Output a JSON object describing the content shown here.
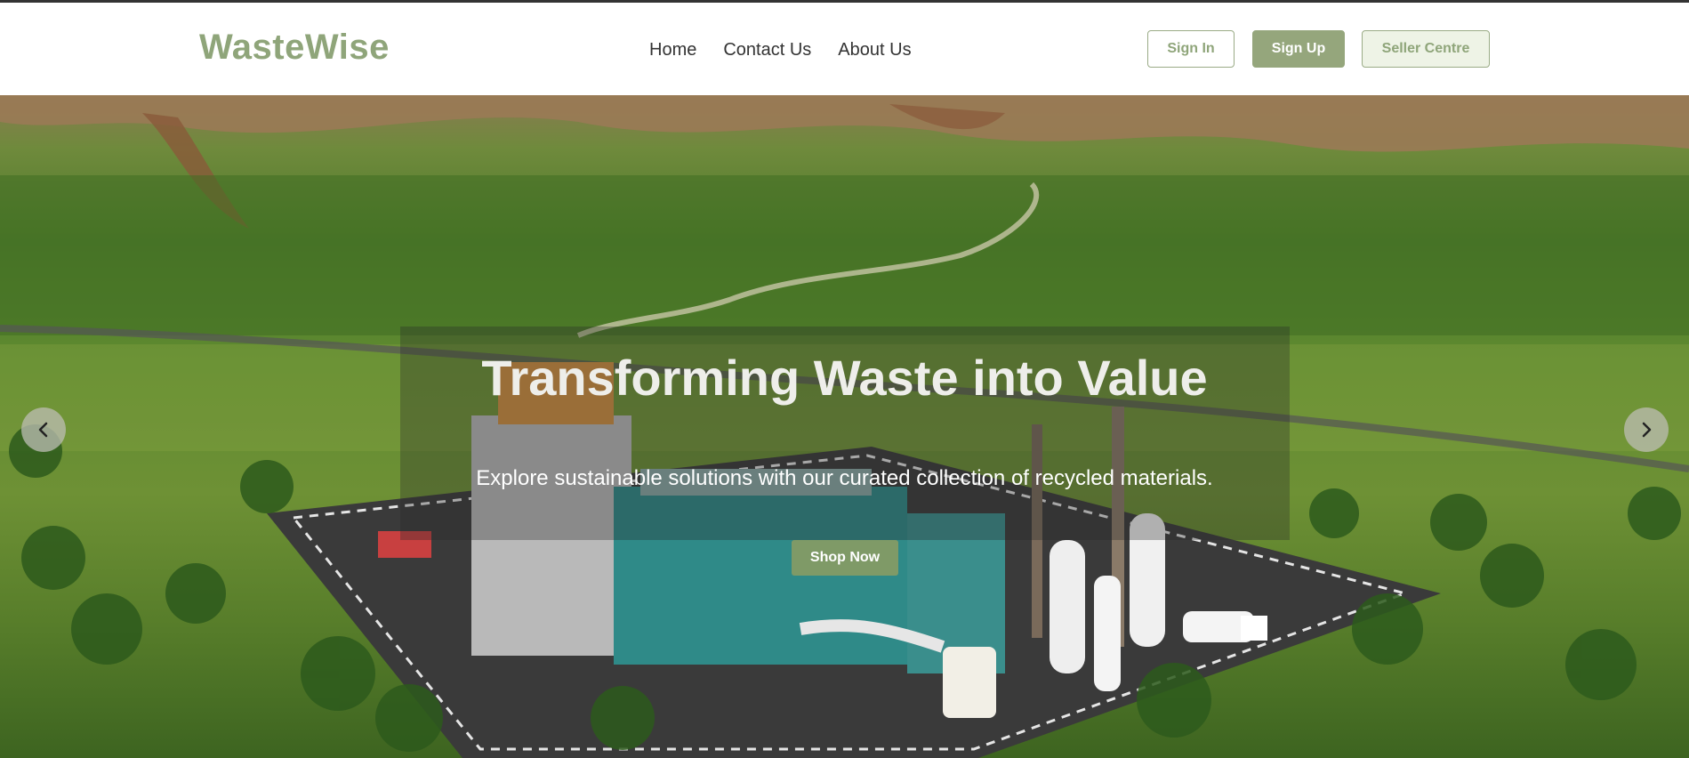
{
  "header": {
    "brand": "WasteWise",
    "nav": [
      "Home",
      "Contact Us",
      "About Us"
    ],
    "buttons": {
      "sign_in": "Sign In",
      "sign_up": "Sign Up",
      "seller_centre": "Seller Centre"
    }
  },
  "hero": {
    "title": "Transforming Waste into Value",
    "subtitle": "Explore sustainable solutions with our curated collection of recycled materials.",
    "cta": "Shop Now",
    "prev_icon": "chevron-left-icon",
    "next_icon": "chevron-right-icon"
  },
  "colors": {
    "brand": "#8fa57a",
    "primary_button": "#95a67c",
    "cta": "#7f9a67"
  }
}
